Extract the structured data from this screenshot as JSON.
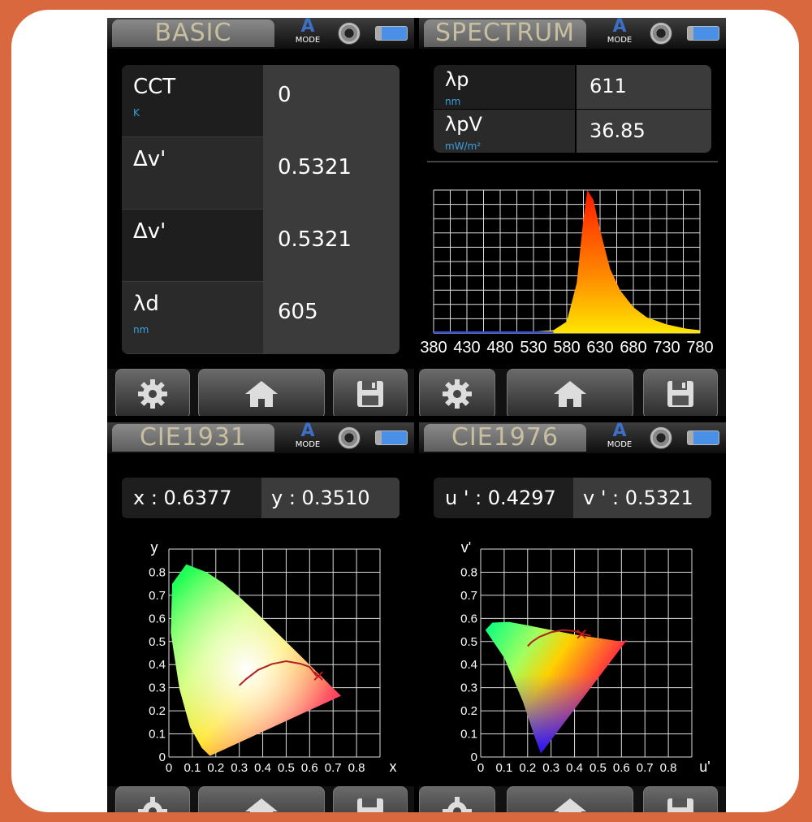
{
  "basic": {
    "title": "BASIC",
    "mode": "MODE",
    "mode_letter": "A",
    "rows": [
      {
        "label": "CCT",
        "unit": "K",
        "value": "0"
      },
      {
        "label": "Δv'",
        "unit": "",
        "value": "0.5321"
      },
      {
        "label": "Δv'",
        "unit": "",
        "value": "0.5321"
      },
      {
        "label": "λd",
        "unit": "nm",
        "value": "605"
      }
    ]
  },
  "spectrum": {
    "title": "SPECTRUM",
    "mode": "MODE",
    "mode_letter": "A",
    "rows": [
      {
        "label": "λp",
        "unit": "nm",
        "value": "611"
      },
      {
        "label": "λpV",
        "unit": "mW/m²",
        "value": "36.85"
      }
    ]
  },
  "cie1931": {
    "title": "CIE1931",
    "mode": "MODE",
    "mode_letter": "A",
    "x_text": "x  :  0.6377",
    "y_text": "y  :  0.3510"
  },
  "cie1976": {
    "title": "CIE1976",
    "mode": "MODE",
    "mode_letter": "A",
    "u_text": "u ' :  0.4297",
    "v_text": "v ' :  0.5321"
  },
  "chart_data": [
    {
      "type": "area",
      "x": [
        380,
        430,
        480,
        530,
        560,
        580,
        595,
        605,
        611,
        620,
        630,
        645,
        660,
        680,
        700,
        730,
        760,
        780
      ],
      "values": [
        0.01,
        0.01,
        0.01,
        0.01,
        0.02,
        0.08,
        0.35,
        0.8,
        1.0,
        0.93,
        0.72,
        0.45,
        0.3,
        0.18,
        0.11,
        0.06,
        0.03,
        0.02
      ],
      "xticks": [
        "380",
        "430",
        "480",
        "530",
        "580",
        "630",
        "680",
        "730",
        "780"
      ],
      "xlim": [
        380,
        780
      ],
      "ylim": [
        0,
        1.0
      ],
      "grid": true
    },
    {
      "type": "scatter",
      "xlabel": "x",
      "ylabel": "y",
      "xlim": [
        0,
        0.9
      ],
      "ylim": [
        0,
        0.9
      ],
      "xticks": [
        "0",
        "0.1",
        "0.2",
        "0.3",
        "0.4",
        "0.5",
        "0.6",
        "0.7",
        "0.8"
      ],
      "yticks": [
        "0",
        "0.1",
        "0.2",
        "0.3",
        "0.4",
        "0.5",
        "0.6",
        "0.7",
        "0.8"
      ],
      "locus": [
        [
          0.175,
          0.005
        ],
        [
          0.14,
          0.04
        ],
        [
          0.09,
          0.13
        ],
        [
          0.045,
          0.295
        ],
        [
          0.008,
          0.538
        ],
        [
          0.014,
          0.75
        ],
        [
          0.074,
          0.834
        ],
        [
          0.16,
          0.8
        ],
        [
          0.23,
          0.754
        ],
        [
          0.302,
          0.692
        ],
        [
          0.374,
          0.624
        ],
        [
          0.444,
          0.554
        ],
        [
          0.512,
          0.487
        ],
        [
          0.575,
          0.424
        ],
        [
          0.627,
          0.372
        ],
        [
          0.665,
          0.334
        ],
        [
          0.69,
          0.308
        ],
        [
          0.734,
          0.265
        ]
      ],
      "planckian": [
        [
          0.3,
          0.31
        ],
        [
          0.33,
          0.338
        ],
        [
          0.38,
          0.377
        ],
        [
          0.44,
          0.403
        ],
        [
          0.5,
          0.415
        ],
        [
          0.56,
          0.404
        ],
        [
          0.6,
          0.39
        ],
        [
          0.63,
          0.35
        ]
      ],
      "points": [
        {
          "x": 0.6377,
          "y": 0.351
        }
      ],
      "grid": true
    },
    {
      "type": "scatter",
      "xlabel": "u'",
      "ylabel": "v'",
      "xlim": [
        0,
        0.9
      ],
      "ylim": [
        0,
        0.9
      ],
      "xticks": [
        "0",
        "0.1",
        "0.2",
        "0.3",
        "0.4",
        "0.5",
        "0.6",
        "0.7",
        "0.8"
      ],
      "yticks": [
        "0",
        "0.1",
        "0.2",
        "0.3",
        "0.4",
        "0.5",
        "0.6",
        "0.7",
        "0.8"
      ],
      "locus": [
        [
          0.257,
          0.016
        ],
        [
          0.226,
          0.1
        ],
        [
          0.18,
          0.24
        ],
        [
          0.1,
          0.43
        ],
        [
          0.02,
          0.55
        ],
        [
          0.05,
          0.582
        ],
        [
          0.12,
          0.585
        ],
        [
          0.2,
          0.57
        ],
        [
          0.3,
          0.55
        ],
        [
          0.4,
          0.53
        ],
        [
          0.5,
          0.515
        ],
        [
          0.56,
          0.506
        ],
        [
          0.6,
          0.5
        ],
        [
          0.623,
          0.506
        ]
      ],
      "planckian": [
        [
          0.2,
          0.48
        ],
        [
          0.22,
          0.5
        ],
        [
          0.25,
          0.52
        ],
        [
          0.3,
          0.54
        ],
        [
          0.35,
          0.55
        ],
        [
          0.4,
          0.545
        ],
        [
          0.43,
          0.535
        ],
        [
          0.47,
          0.525
        ]
      ],
      "points": [
        {
          "x": 0.4297,
          "y": 0.5321
        }
      ],
      "grid": true
    }
  ]
}
